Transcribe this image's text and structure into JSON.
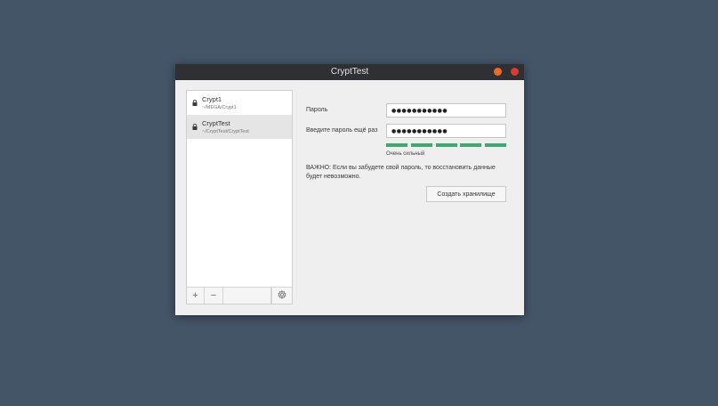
{
  "window": {
    "title": "CryptTest"
  },
  "sidebar": {
    "items": [
      {
        "name": "Crypt1",
        "path": "~/MEGA/Crypt1",
        "icon": "lock-icon",
        "selected": false
      },
      {
        "name": "CryptTest",
        "path": "~/CryptTest/CryptTest",
        "icon": "lock-icon",
        "selected": true
      }
    ],
    "toolbar": {
      "add_label": "+",
      "remove_label": "−",
      "settings_icon": "gear-icon"
    }
  },
  "form": {
    "password_label": "Пароль",
    "password_value": "●●●●●●●●●●●",
    "confirm_label": "Введите пароль ещё раз",
    "confirm_value": "●●●●●●●●●●●",
    "strength_segments_filled": 5,
    "strength_segments_total": 5,
    "strength_color": "#3ea870",
    "strength_label": "Очень сильный",
    "warning": "ВАЖНО: Если вы забудете свой пароль, то восстановить данные будет невозможно.",
    "create_button_label": "Создать хранилище"
  },
  "colors": {
    "desktop": "#445568",
    "titlebar": "#2e3033",
    "minimize": "#ea6a26",
    "close": "#d83b2f"
  }
}
